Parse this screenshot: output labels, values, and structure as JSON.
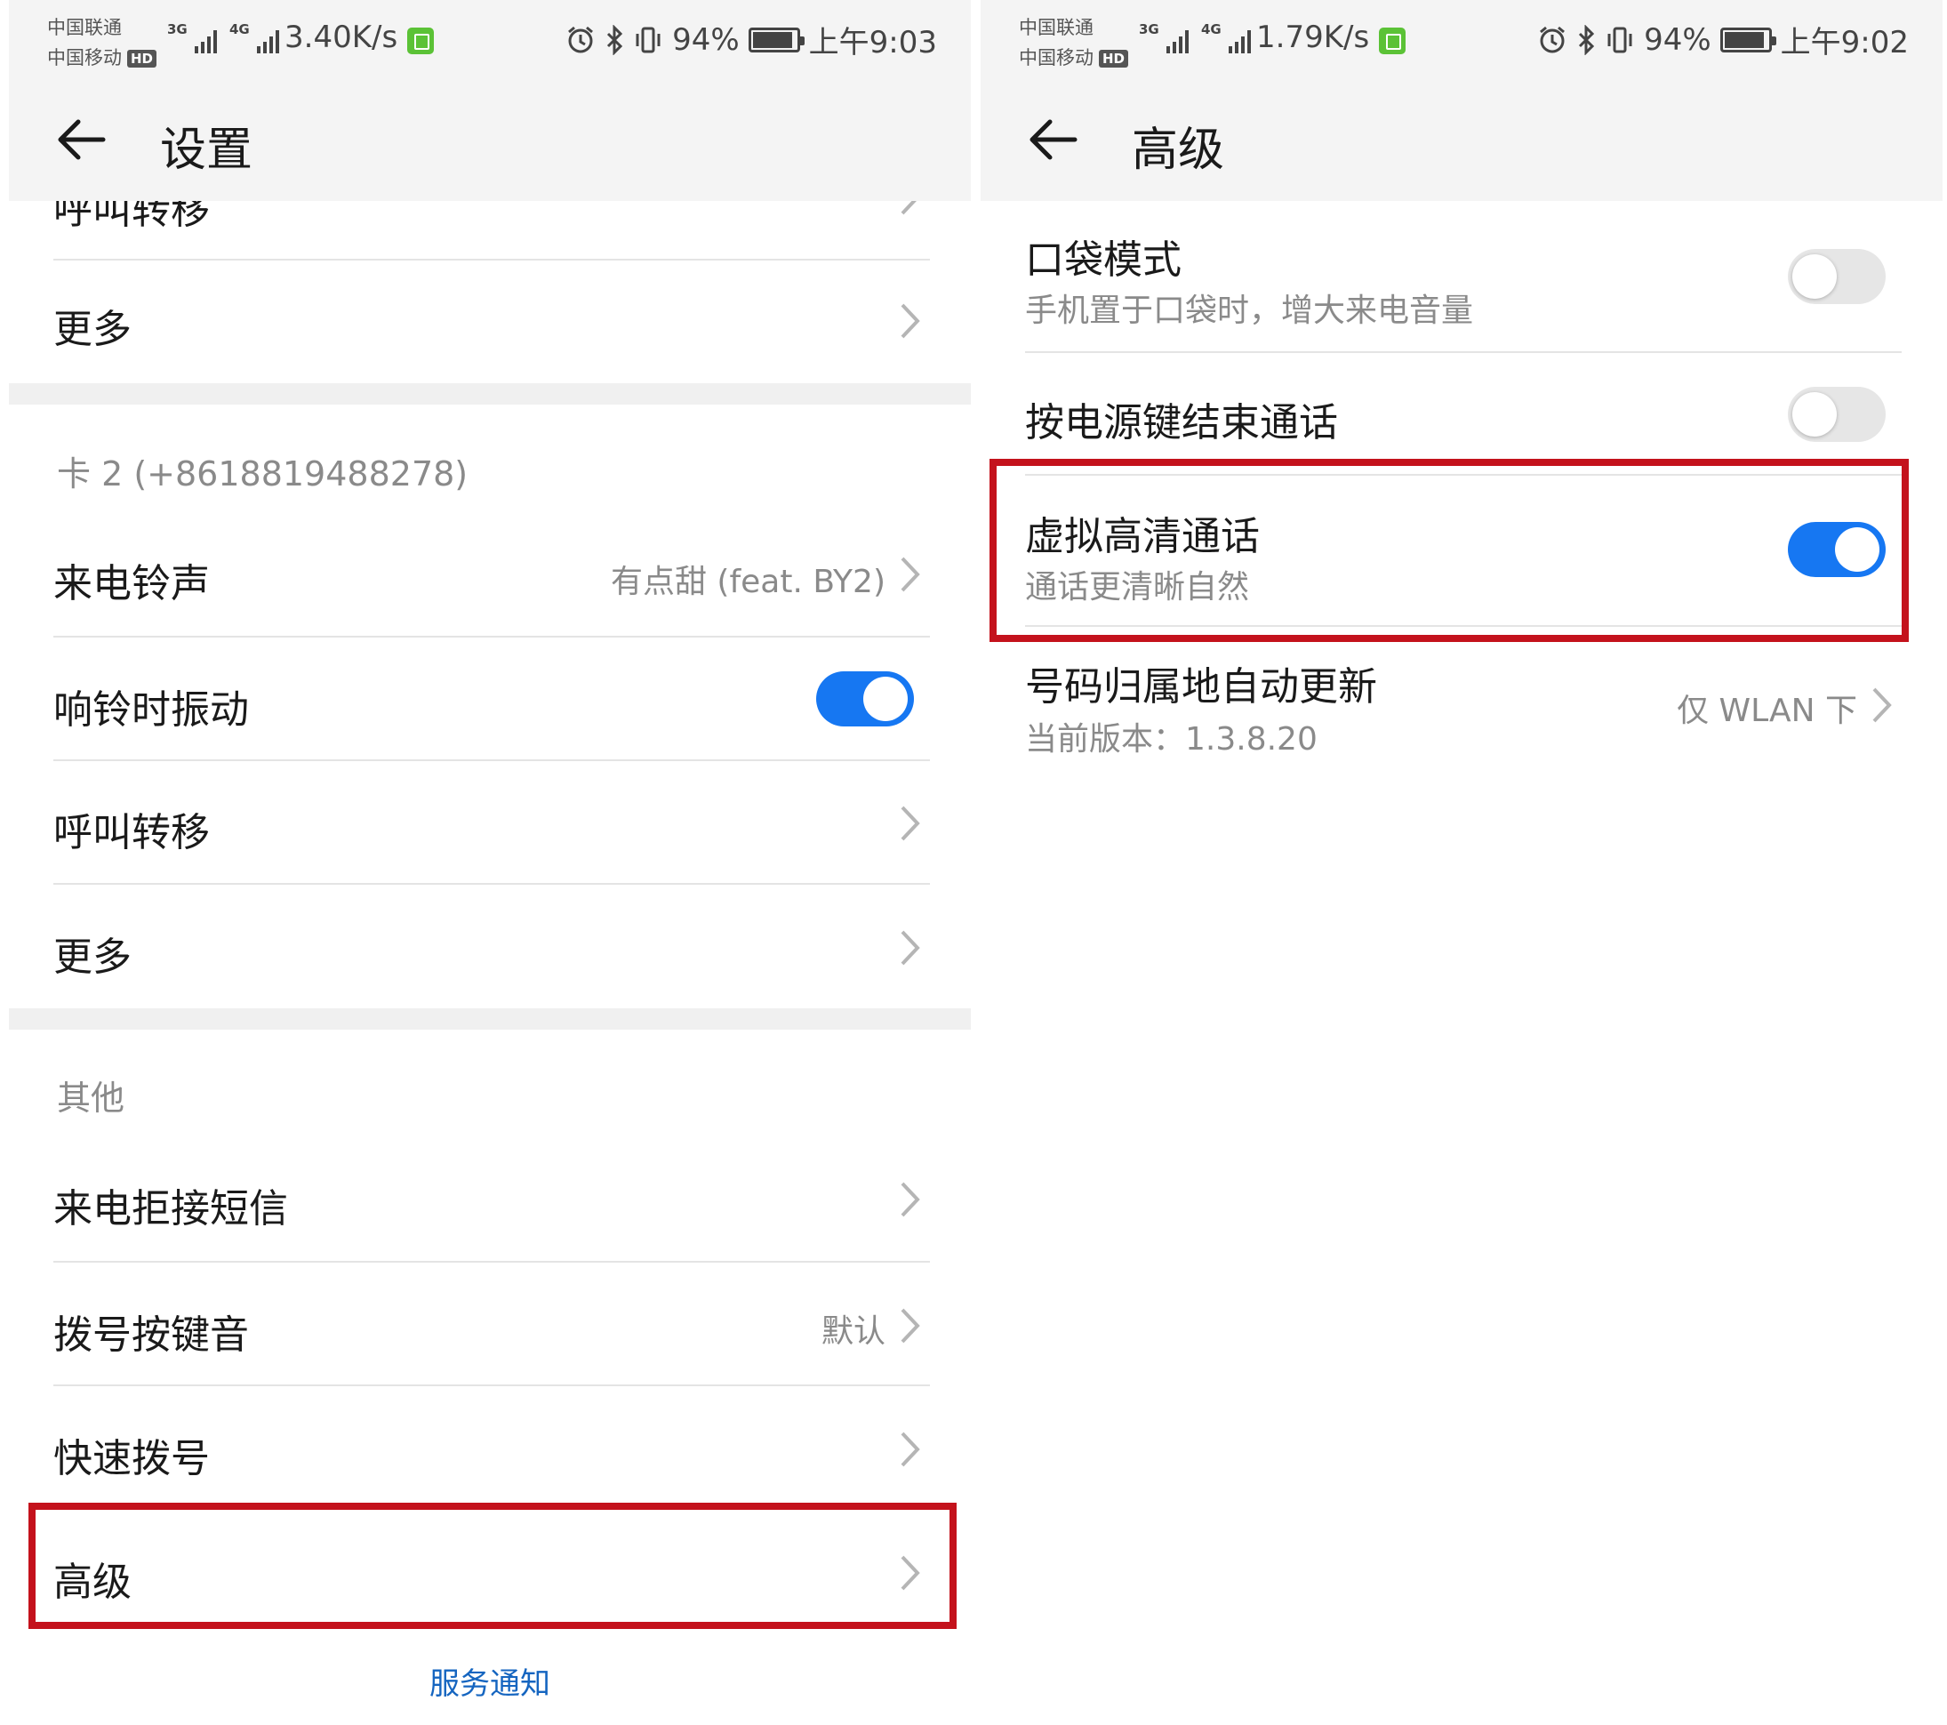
{
  "left": {
    "status": {
      "carrier1": "中国联通",
      "carrier2": "中国移动",
      "hd": "HD",
      "net1": "3G",
      "net2": "4G",
      "speed": "3.40K/s",
      "battery": "94%",
      "time": "上午9:03"
    },
    "title": "设置",
    "clipped_row": "呼叫转移",
    "more_1": "更多",
    "card2_header": "卡 2 (+8618819488278)",
    "ringtone": {
      "label": "来电铃声",
      "value": "有点甜 (feat. BY2)"
    },
    "vibrate": {
      "label": "响铃时振动",
      "state": "on"
    },
    "forwarding": "呼叫转移",
    "more_2": "更多",
    "other_header": "其他",
    "reject_sms": "来电拒接短信",
    "dial_tone": {
      "label": "拨号按键音",
      "value": "默认"
    },
    "speed_dial": "快速拨号",
    "advanced": "高级",
    "service_link": "服务通知"
  },
  "right": {
    "status": {
      "carrier1": "中国联通",
      "carrier2": "中国移动",
      "hd": "HD",
      "net1": "3G",
      "net2": "4G",
      "speed": "1.79K/s",
      "battery": "94%",
      "time": "上午9:02"
    },
    "title": "高级",
    "pocket_mode": {
      "label": "口袋模式",
      "sub": "手机置于口袋时，增大来电音量",
      "state": "off"
    },
    "power_end": {
      "label": "按电源键结束通话",
      "state": "off"
    },
    "hd_call": {
      "label": "虚拟高清通话",
      "sub": "通话更清晰自然",
      "state": "on"
    },
    "number_update": {
      "label": "号码归属地自动更新",
      "sub": "当前版本：1.3.8.20",
      "value": "仅 WLAN 下"
    }
  },
  "colors": {
    "accent_blue": "#1677f2",
    "highlight_red": "#c4121c",
    "link_blue": "#1565c0"
  }
}
